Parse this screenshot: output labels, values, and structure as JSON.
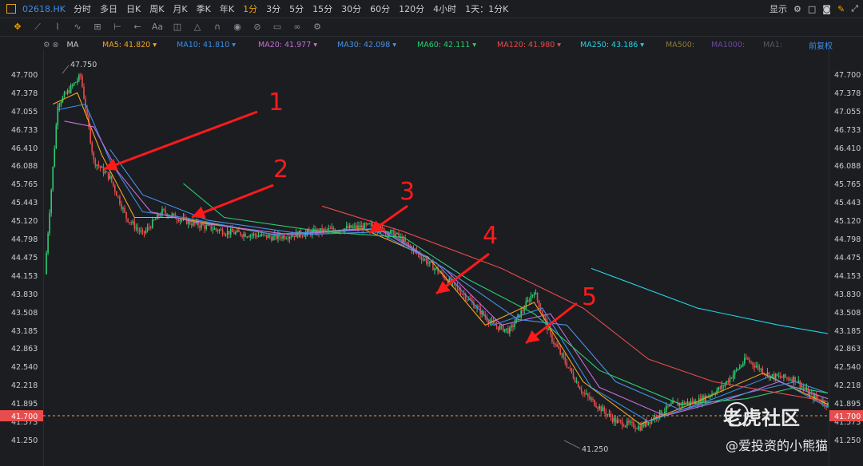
{
  "toolbar": {
    "symbol": "02618.HK",
    "timeframes": [
      "分时",
      "多日",
      "日K",
      "周K",
      "月K",
      "季K",
      "年K",
      "1分",
      "3分",
      "5分",
      "15分",
      "30分",
      "60分",
      "120分",
      "4小时",
      "1天：1分K"
    ],
    "active_index": 7,
    "display_label": "显示"
  },
  "ma_legend": {
    "type_label": "MA",
    "items": [
      {
        "text": "MA5: 41.820",
        "color": "#f5a623"
      },
      {
        "text": "MA10: 41.810",
        "color": "#3a8ee6"
      },
      {
        "text": "MA20: 41.977",
        "color": "#c86dd7"
      },
      {
        "text": "MA30: 42.098",
        "color": "#4a90e2"
      },
      {
        "text": "MA60: 42.111",
        "color": "#2ecc71"
      },
      {
        "text": "MA120: 41.980",
        "color": "#e84c4c"
      },
      {
        "text": "MA250: 43.186",
        "color": "#22d3e6"
      },
      {
        "text": "MA500:",
        "color": "#8a7a3a"
      },
      {
        "text": "MA1000:",
        "color": "#6a4a9a"
      },
      {
        "text": "MA1:",
        "color": "#555a60"
      }
    ],
    "adjust_label": "前复权"
  },
  "y_ticks": [
    "47.700",
    "47.378",
    "47.055",
    "46.733",
    "46.410",
    "46.088",
    "45.765",
    "45.443",
    "45.120",
    "44.798",
    "44.475",
    "44.153",
    "43.830",
    "43.508",
    "43.185",
    "42.863",
    "42.540",
    "42.218",
    "41.895",
    "41.573",
    "41.250"
  ],
  "current_price": "41.700",
  "high_label": "47.750",
  "low_label": "41.250",
  "annotations": [
    "1",
    "2",
    "3",
    "4",
    "5"
  ],
  "watermark": {
    "brand": "老虎社区",
    "author": "@爱投资的小熊猫"
  },
  "colors": {
    "up": "#2ecc71",
    "down": "#e84c4c",
    "arrow": "#ff1a1a",
    "background": "#1b1d21"
  },
  "chart_data": {
    "type": "line",
    "title": "",
    "ylim": [
      41.25,
      47.75
    ],
    "price_path": [
      [
        0,
        44.2
      ],
      [
        8,
        47.2
      ],
      [
        22,
        47.7
      ],
      [
        30,
        46.2
      ],
      [
        40,
        45.9
      ],
      [
        50,
        45.2
      ],
      [
        60,
        44.9
      ],
      [
        72,
        45.3
      ],
      [
        90,
        45.1
      ],
      [
        110,
        44.95
      ],
      [
        140,
        44.85
      ],
      [
        175,
        44.98
      ],
      [
        200,
        45.05
      ],
      [
        215,
        44.9
      ],
      [
        235,
        44.4
      ],
      [
        255,
        43.9
      ],
      [
        275,
        43.3
      ],
      [
        285,
        43.2
      ],
      [
        300,
        43.9
      ],
      [
        310,
        43.1
      ],
      [
        330,
        42.1
      ],
      [
        350,
        41.6
      ],
      [
        365,
        41.5
      ],
      [
        385,
        41.9
      ],
      [
        400,
        41.95
      ],
      [
        415,
        42.2
      ],
      [
        430,
        42.7
      ],
      [
        445,
        42.4
      ],
      [
        460,
        42.35
      ],
      [
        470,
        42.05
      ],
      [
        480,
        41.9
      ]
    ],
    "series": [
      {
        "name": "MA5",
        "values": [
          [
            5,
            47.2
          ],
          [
            20,
            47.4
          ],
          [
            35,
            46.3
          ],
          [
            55,
            45.2
          ],
          [
            80,
            45.2
          ],
          [
            140,
            44.9
          ],
          [
            195,
            45.0
          ],
          [
            235,
            44.5
          ],
          [
            270,
            43.3
          ],
          [
            300,
            43.7
          ],
          [
            330,
            42.3
          ],
          [
            365,
            41.55
          ],
          [
            400,
            41.95
          ],
          [
            440,
            42.45
          ],
          [
            480,
            41.9
          ]
        ]
      },
      {
        "name": "MA10",
        "values": [
          [
            8,
            47.1
          ],
          [
            25,
            47.2
          ],
          [
            40,
            46.2
          ],
          [
            60,
            45.3
          ],
          [
            85,
            45.2
          ],
          [
            140,
            44.9
          ],
          [
            200,
            45.0
          ],
          [
            240,
            44.4
          ],
          [
            275,
            43.3
          ],
          [
            305,
            43.6
          ],
          [
            335,
            42.2
          ],
          [
            370,
            41.6
          ],
          [
            410,
            42.0
          ],
          [
            445,
            42.4
          ],
          [
            480,
            41.85
          ]
        ]
      },
      {
        "name": "MA20",
        "values": [
          [
            12,
            46.9
          ],
          [
            30,
            46.8
          ],
          [
            45,
            46.0
          ],
          [
            65,
            45.3
          ],
          [
            95,
            45.1
          ],
          [
            150,
            44.9
          ],
          [
            205,
            45.0
          ],
          [
            245,
            44.3
          ],
          [
            280,
            43.3
          ],
          [
            310,
            43.5
          ],
          [
            340,
            42.2
          ],
          [
            380,
            41.7
          ],
          [
            420,
            42.0
          ],
          [
            450,
            42.3
          ],
          [
            480,
            42.0
          ]
        ]
      },
      {
        "name": "MA30",
        "values": [
          [
            40,
            46.4
          ],
          [
            60,
            45.6
          ],
          [
            100,
            45.15
          ],
          [
            160,
            44.9
          ],
          [
            210,
            44.95
          ],
          [
            250,
            44.2
          ],
          [
            290,
            43.4
          ],
          [
            320,
            43.3
          ],
          [
            350,
            42.3
          ],
          [
            390,
            41.8
          ],
          [
            430,
            42.1
          ],
          [
            460,
            42.3
          ],
          [
            480,
            42.1
          ]
        ]
      },
      {
        "name": "MA60",
        "values": [
          [
            85,
            45.8
          ],
          [
            110,
            45.2
          ],
          [
            170,
            44.95
          ],
          [
            220,
            44.85
          ],
          [
            260,
            44.1
          ],
          [
            300,
            43.5
          ],
          [
            340,
            42.5
          ],
          [
            390,
            41.9
          ],
          [
            430,
            42.0
          ],
          [
            460,
            42.2
          ],
          [
            480,
            42.1
          ]
        ]
      },
      {
        "name": "MA120",
        "values": [
          [
            170,
            45.4
          ],
          [
            220,
            44.95
          ],
          [
            280,
            44.3
          ],
          [
            330,
            43.6
          ],
          [
            370,
            42.7
          ],
          [
            410,
            42.3
          ],
          [
            450,
            42.1
          ],
          [
            480,
            41.95
          ]
        ]
      },
      {
        "name": "MA250",
        "values": [
          [
            335,
            44.3
          ],
          [
            400,
            43.6
          ],
          [
            450,
            43.3
          ],
          [
            480,
            43.15
          ]
        ]
      }
    ]
  }
}
